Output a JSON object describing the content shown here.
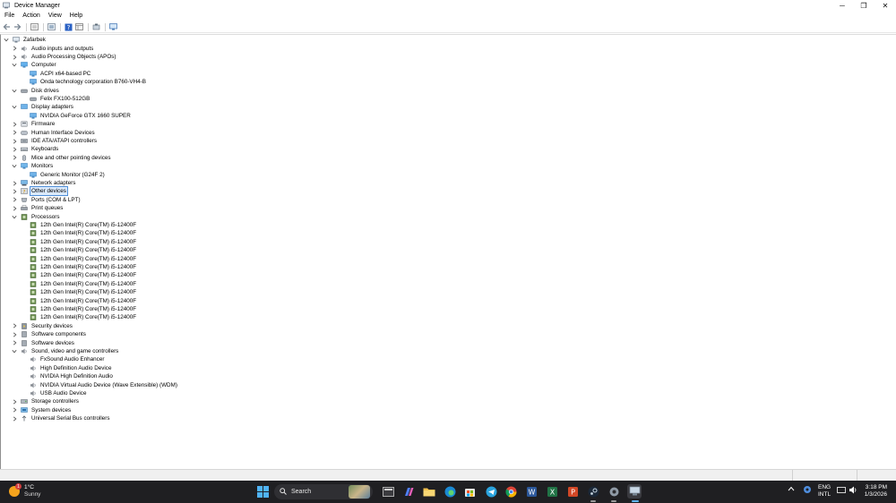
{
  "window": {
    "title": "Device Manager",
    "controls": {
      "minimize": "─",
      "maximize": "❐",
      "close": "✕"
    }
  },
  "menu": [
    "File",
    "Action",
    "View",
    "Help"
  ],
  "toolbar": [
    "back-icon",
    "forward-icon",
    "properties-icon",
    "list-icon",
    "help-icon",
    "view-icon",
    "scan-icon",
    "monitor-icon"
  ],
  "tree": {
    "root": "Zafarbek",
    "nodes": [
      {
        "label": "Audio inputs and outputs",
        "icon": "speaker-icon",
        "expanded": false
      },
      {
        "label": "Audio Processing Objects (APOs)",
        "icon": "speaker-icon",
        "expanded": false
      },
      {
        "label": "Computer",
        "icon": "computer-icon",
        "expanded": true,
        "children": [
          "ACPI x64-based PC",
          "Onda technology corporation B760-VH4-B"
        ]
      },
      {
        "label": "Disk drives",
        "icon": "disk-icon",
        "expanded": true,
        "children": [
          "Felix FX100-512GB"
        ]
      },
      {
        "label": "Display adapters",
        "icon": "display-icon",
        "expanded": true,
        "children": [
          "NVIDIA GeForce GTX 1660 SUPER"
        ]
      },
      {
        "label": "Firmware",
        "icon": "firmware-icon",
        "expanded": false
      },
      {
        "label": "Human Interface Devices",
        "icon": "hid-icon",
        "expanded": false
      },
      {
        "label": "IDE ATA/ATAPI controllers",
        "icon": "ide-icon",
        "expanded": false
      },
      {
        "label": "Keyboards",
        "icon": "keyboard-icon",
        "expanded": false
      },
      {
        "label": "Mice and other pointing devices",
        "icon": "mouse-icon",
        "expanded": false
      },
      {
        "label": "Monitors",
        "icon": "monitor-icon",
        "expanded": true,
        "children": [
          "Generic Monitor (G24F 2)"
        ]
      },
      {
        "label": "Network adapters",
        "icon": "network-icon",
        "expanded": false
      },
      {
        "label": "Other devices",
        "icon": "other-devices-icon",
        "expanded": false,
        "selected": true
      },
      {
        "label": "Ports (COM & LPT)",
        "icon": "port-icon",
        "expanded": false
      },
      {
        "label": "Print queues",
        "icon": "printer-icon",
        "expanded": false
      },
      {
        "label": "Processors",
        "icon": "processor-icon",
        "expanded": true,
        "children": [
          "12th Gen Intel(R) Core(TM) i5-12400F",
          "12th Gen Intel(R) Core(TM) i5-12400F",
          "12th Gen Intel(R) Core(TM) i5-12400F",
          "12th Gen Intel(R) Core(TM) i5-12400F",
          "12th Gen Intel(R) Core(TM) i5-12400F",
          "12th Gen Intel(R) Core(TM) i5-12400F",
          "12th Gen Intel(R) Core(TM) i5-12400F",
          "12th Gen Intel(R) Core(TM) i5-12400F",
          "12th Gen Intel(R) Core(TM) i5-12400F",
          "12th Gen Intel(R) Core(TM) i5-12400F",
          "12th Gen Intel(R) Core(TM) i5-12400F",
          "12th Gen Intel(R) Core(TM) i5-12400F"
        ]
      },
      {
        "label": "Security devices",
        "icon": "security-icon",
        "expanded": false
      },
      {
        "label": "Software components",
        "icon": "software-icon",
        "expanded": false
      },
      {
        "label": "Software devices",
        "icon": "software-icon",
        "expanded": false
      },
      {
        "label": "Sound, video and game controllers",
        "icon": "speaker-icon",
        "expanded": true,
        "children": [
          "FxSound Audio Enhancer",
          "High Definition Audio Device",
          "NVIDIA High Definition Audio",
          "NVIDIA Virtual Audio Device (Wave Extensible) (WDM)",
          "USB Audio Device"
        ]
      },
      {
        "label": "Storage controllers",
        "icon": "storage-icon",
        "expanded": false
      },
      {
        "label": "System devices",
        "icon": "system-icon",
        "expanded": false
      },
      {
        "label": "Universal Serial Bus controllers",
        "icon": "usb-icon",
        "expanded": false
      }
    ]
  },
  "taskbar": {
    "weather": {
      "temp": "1°C",
      "condition": "Sunny",
      "badge": "1"
    },
    "search_label": "Search",
    "apps": [
      "file-explorer-icon",
      "copilot-icon",
      "folder-icon",
      "edge-icon",
      "store-icon",
      "telegram-icon",
      "chrome-icon",
      "word-icon",
      "excel-icon",
      "powerpoint-icon",
      "steam-icon",
      "settings-icon",
      "device-manager-icon"
    ],
    "tray": {
      "language": "ENG",
      "layout": "INTL"
    },
    "clock": {
      "time": "3:18 PM",
      "date": "1/3/2026"
    }
  },
  "colors": {
    "selection": "#dbeafc",
    "selection_border": "#4f8fd8",
    "taskbar": "#1f1f22",
    "folder": "#f2c14e"
  }
}
